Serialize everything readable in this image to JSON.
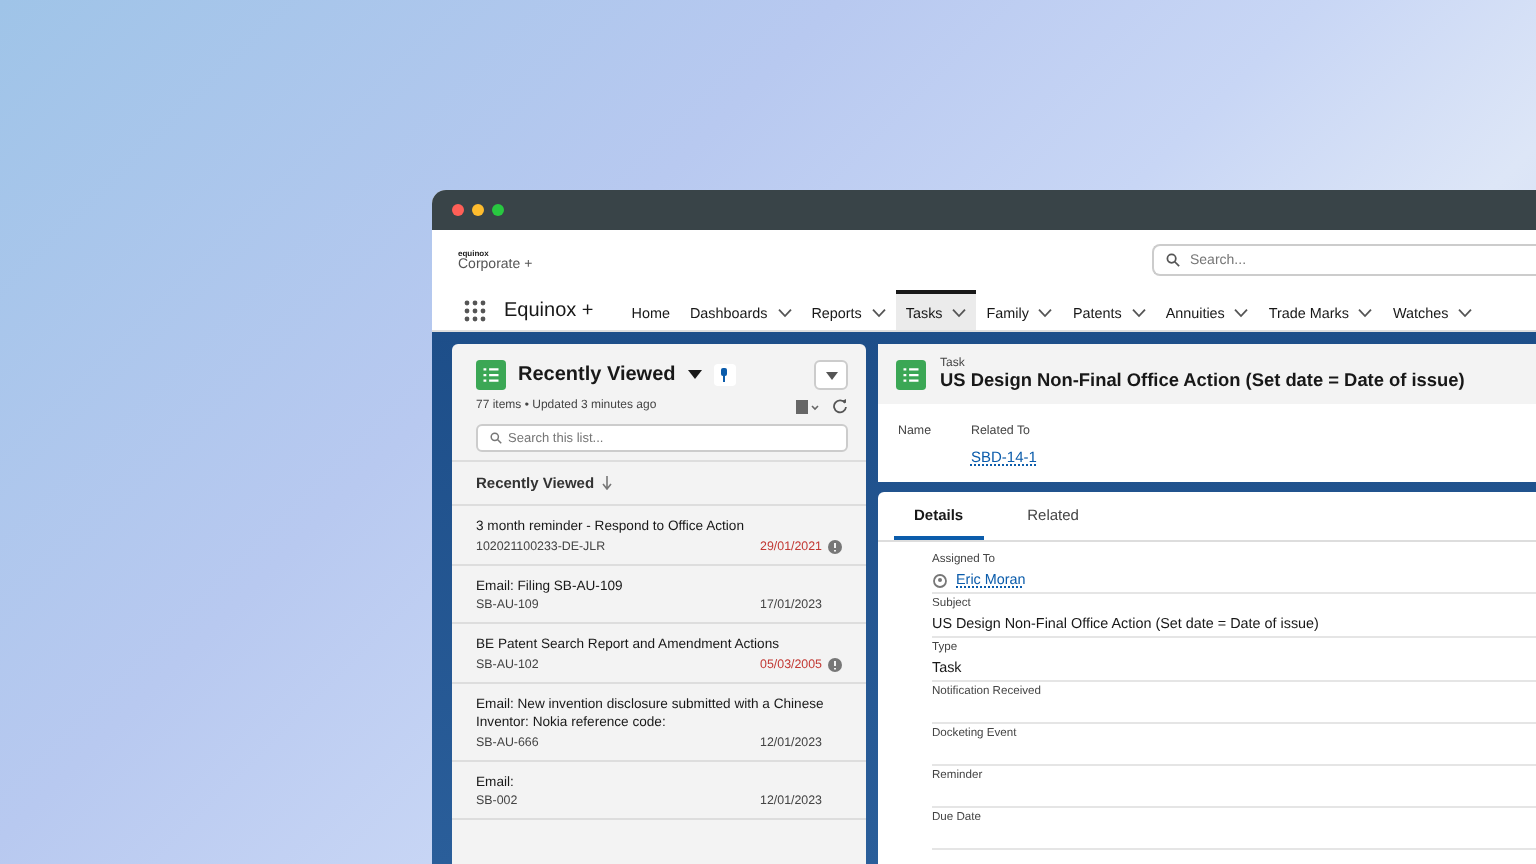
{
  "header": {
    "logo_small": "equinox",
    "logo": "Corporate +",
    "search": {
      "placeholder": "Search..."
    }
  },
  "nav": {
    "app_name": "Equinox +",
    "items": [
      {
        "label": "Home",
        "selected": false,
        "menu": false
      },
      {
        "label": "Dashboards",
        "selected": false,
        "menu": true
      },
      {
        "label": "Reports",
        "selected": false,
        "menu": true
      },
      {
        "label": "Tasks",
        "selected": true,
        "menu": true
      },
      {
        "label": "Family",
        "selected": false,
        "menu": true
      },
      {
        "label": "Patents",
        "selected": false,
        "menu": true
      },
      {
        "label": "Annuities",
        "selected": false,
        "menu": true
      },
      {
        "label": "Trade Marks",
        "selected": false,
        "menu": true
      },
      {
        "label": "Watches",
        "selected": false,
        "menu": true
      }
    ]
  },
  "list_view": {
    "title": "Recently Viewed",
    "status": "77 items • Updated 3 minutes ago",
    "search": {
      "placeholder": "Search this list..."
    },
    "column": "Recently Viewed",
    "rows": [
      {
        "title": "3 month reminder - Respond to Office Action",
        "ref": "102021100233-DE-JLR",
        "date": "29/01/2021",
        "overdue": true
      },
      {
        "title": "Email: Filing SB-AU-109",
        "ref": "SB-AU-109",
        "date": "17/01/2023",
        "overdue": false
      },
      {
        "title": "BE Patent Search Report and Amendment Actions",
        "ref": "SB-AU-102",
        "date": "05/03/2005",
        "overdue": true
      },
      {
        "title": "Email: New invention disclosure submitted with a Chinese Inventor: Nokia reference code:",
        "ref": "SB-AU-666",
        "date": "12/01/2023",
        "overdue": false
      },
      {
        "title": "Email:",
        "ref": "SB-002",
        "date": "12/01/2023",
        "overdue": false
      }
    ]
  },
  "record": {
    "type": "Task",
    "title": "US Design Non-Final Office Action (Set date = Date of issue)",
    "highlights": [
      {
        "label": "Name"
      },
      {
        "label": "Related To",
        "value": "SBD-14-1"
      }
    ],
    "tabs": [
      {
        "label": "Details",
        "selected": true
      },
      {
        "label": "Related",
        "selected": false
      }
    ],
    "fields": [
      {
        "label": "Assigned To",
        "value": "Eric Moran",
        "kind": "user"
      },
      {
        "label": "Subject",
        "value": "US Design Non-Final Office Action (Set date = Date of issue)",
        "kind": "text"
      },
      {
        "label": "Type",
        "value": "Task",
        "kind": "text"
      },
      {
        "label": "Notification Received",
        "kind": "text"
      },
      {
        "label": "Docketing Event",
        "kind": "text"
      },
      {
        "label": "Reminder",
        "kind": "text"
      },
      {
        "label": "Due Date",
        "kind": "text"
      }
    ]
  }
}
